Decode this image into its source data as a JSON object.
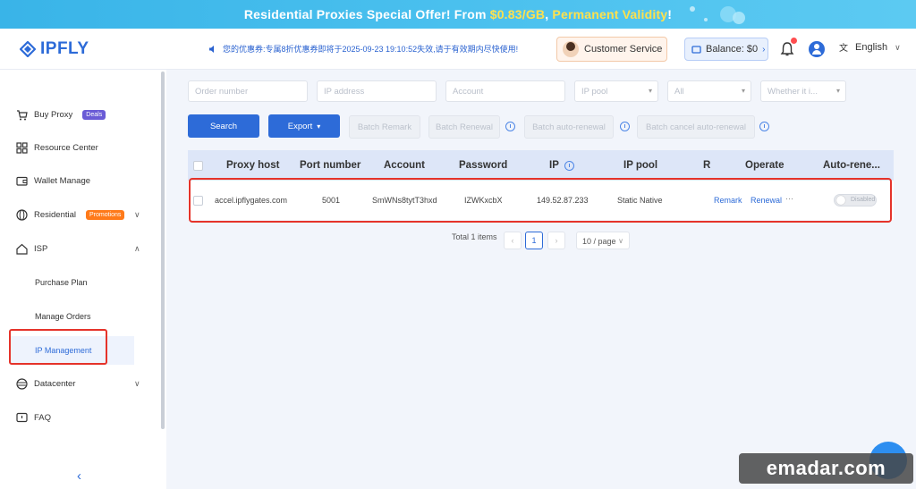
{
  "banner": {
    "text_prefix": "Residential Proxies Special Offer! From ",
    "price": "$0.83/GB",
    "text_middle": ", ",
    "highlight": "Permanent Validity",
    "text_suffix": "!"
  },
  "header": {
    "logo": "IPFLY",
    "notice": "您的优惠券:专属8折优惠券即将于2025-09-23 19:10:52失效,请于有效期内尽快使用!",
    "customer_service": "Customer Service",
    "balance": "Balance: $0",
    "language": "English"
  },
  "sidebar": {
    "items": [
      {
        "label": "Buy Proxy",
        "badge": "Deals",
        "icon": "cart-icon"
      },
      {
        "label": "Resource Center",
        "icon": "grid-icon"
      },
      {
        "label": "Wallet Manage",
        "icon": "wallet-icon"
      },
      {
        "label": "Residential",
        "badge": "Promotions",
        "icon": "globe-icon"
      },
      {
        "label": "ISP",
        "icon": "home-icon"
      },
      {
        "label": "Datacenter",
        "icon": "server-icon"
      },
      {
        "label": "FAQ",
        "icon": "faq-icon"
      }
    ],
    "isp_sub": [
      "Purchase Plan",
      "Manage Orders",
      "IP Management"
    ]
  },
  "filters": {
    "order_number": "Order number",
    "ip_address": "IP address",
    "account": "Account",
    "ip_pool": "IP pool",
    "all": "All",
    "whether": "Whether it i..."
  },
  "actions": {
    "search": "Search",
    "export": "Export",
    "batch_remark": "Batch Remark",
    "batch_renewal": "Batch Renewal",
    "batch_auto_renewal": "Batch auto-renewal",
    "batch_cancel_auto_renewal": "Batch cancel auto-renewal"
  },
  "table": {
    "headers": [
      "Proxy host",
      "Port number",
      "Account",
      "Password",
      "IP",
      "IP pool",
      "R",
      "Operate",
      "Auto-rene..."
    ],
    "rows": [
      {
        "proxy_host": "accel.ipflygates.com",
        "port": "5001",
        "account": "SmWNs8tytT3hxd",
        "password": "IZWKxcbX",
        "ip": "149.52.87.233",
        "ip_pool": "Static Native",
        "remark": "Remark",
        "renewal": "Renewal",
        "more": "···",
        "auto_renew": "Disabled"
      }
    ]
  },
  "pagination": {
    "total": "Total 1 items",
    "current_page": "1",
    "page_size": "10 / page"
  },
  "watermark": "emadar.com"
}
